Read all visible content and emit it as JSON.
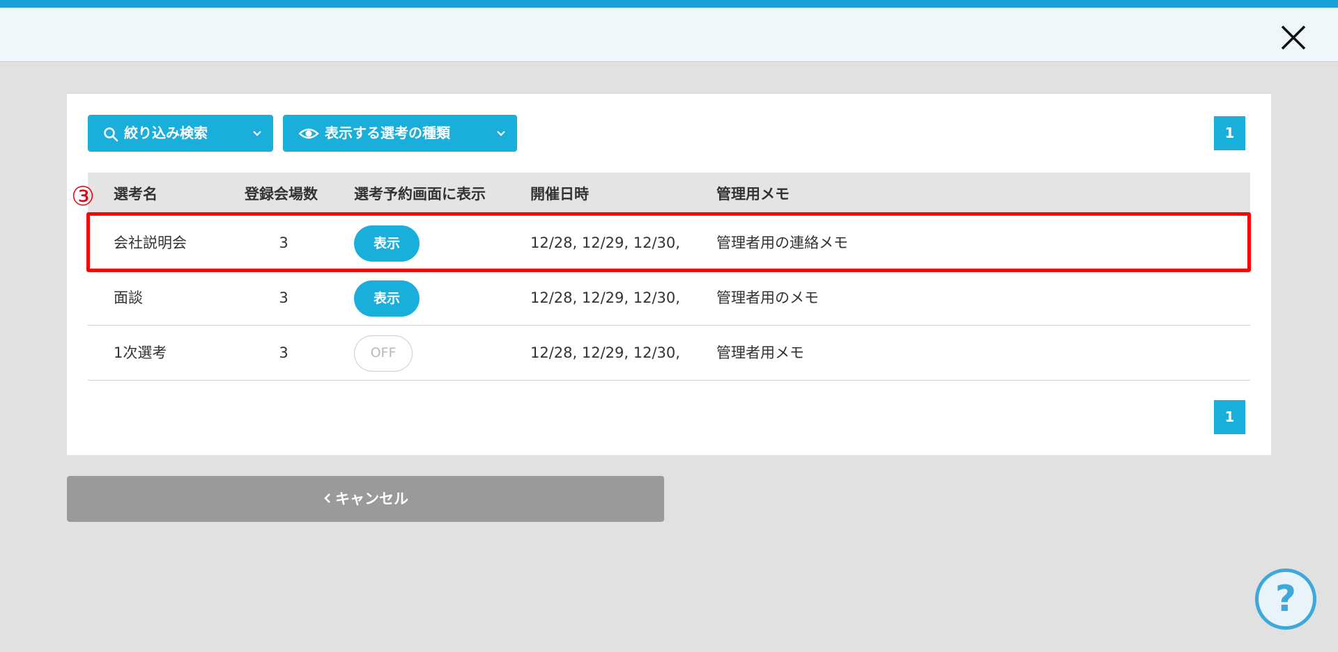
{
  "header": {
    "close_icon": "close-icon"
  },
  "toolbar": {
    "filter_label": "絞り込み検索",
    "filter_icon": "search-icon",
    "types_label": "表示する選考の種類",
    "types_icon": "eye-icon"
  },
  "pagination": {
    "top_page": "1",
    "bottom_page": "1"
  },
  "table": {
    "headers": [
      "選考名",
      "登録会場数",
      "選考予約画面に表示",
      "開催日時",
      "管理用メモ"
    ],
    "rows": [
      {
        "name": "会社説明会",
        "venues": "3",
        "display": "表示",
        "display_on": true,
        "dates": "12/28, 12/29, 12/30,",
        "memo": "管理者用の連絡メモ"
      },
      {
        "name": "面談",
        "venues": "3",
        "display": "表示",
        "display_on": true,
        "dates": "12/28, 12/29, 12/30,",
        "memo": "管理者用のメモ"
      },
      {
        "name": "1次選考",
        "venues": "3",
        "display": "OFF",
        "display_on": false,
        "dates": "12/28, 12/29, 12/30,",
        "memo": "管理者用メモ"
      }
    ]
  },
  "annotation": {
    "step_marker": "③",
    "highlight_color": "#ff0000"
  },
  "footer": {
    "cancel_label": "キャンセル",
    "help_label": "?"
  },
  "colors": {
    "accent": "#1aaedb",
    "top_bar": "#1a9fd6",
    "cancel_bg": "#9a9a9a"
  }
}
